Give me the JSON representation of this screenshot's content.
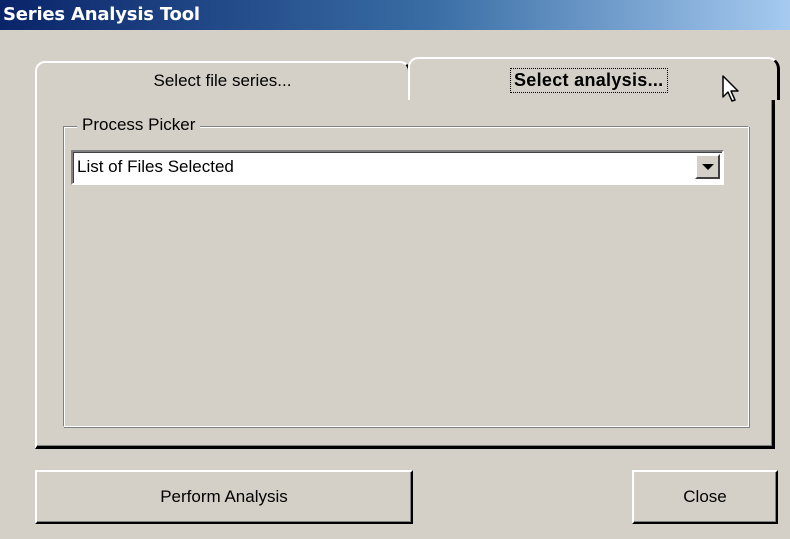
{
  "window": {
    "title": "Series Analysis Tool"
  },
  "tabs": [
    {
      "label": "Select file series...",
      "selected": false
    },
    {
      "label": "Select analysis...",
      "selected": true
    }
  ],
  "process_picker": {
    "legend": "Process Picker",
    "selected_value": "List of Files Selected"
  },
  "buttons": {
    "perform": "Perform Analysis",
    "close": "Close"
  },
  "colors": {
    "face": "#d4d0c8",
    "titlebar_start": "#0a246a",
    "titlebar_end": "#a6caf0"
  }
}
